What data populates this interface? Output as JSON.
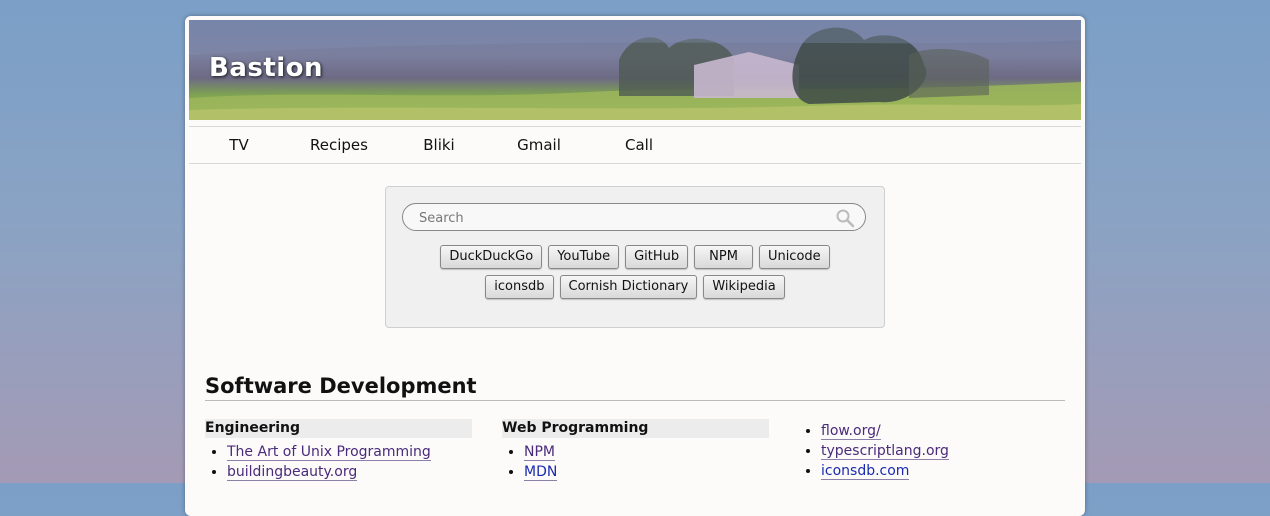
{
  "site": {
    "title": "Bastion"
  },
  "nav": {
    "items": [
      "TV",
      "Recipes",
      "Bliki",
      "Gmail",
      "Call"
    ]
  },
  "search": {
    "placeholder": "Search",
    "buttons_row1": [
      "DuckDuckGo",
      "YouTube",
      "GitHub",
      "NPM",
      "Unicode"
    ],
    "buttons_row2": [
      "iconsdb",
      "Cornish Dictionary",
      "Wikipedia"
    ]
  },
  "section": {
    "title": "Software Development",
    "columns": [
      {
        "heading": "Engineering",
        "links": [
          "The Art of Unix Programming",
          "buildingbeauty.org"
        ]
      },
      {
        "heading": "Web Programming",
        "links": [
          "NPM",
          "MDN"
        ]
      },
      {
        "heading": "",
        "links": [
          "flow.org/",
          "typescriptlang.org",
          "iconsdb.com"
        ]
      }
    ]
  }
}
